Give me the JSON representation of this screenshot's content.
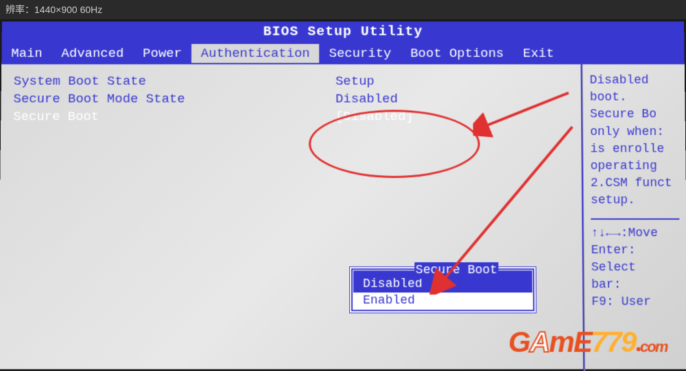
{
  "monitor": {
    "resolution_label": "辨率：1440×900 60Hz"
  },
  "bios": {
    "title": "BIOS Setup Utility",
    "menu": {
      "items": [
        {
          "label": "Main"
        },
        {
          "label": "Advanced"
        },
        {
          "label": "Power"
        },
        {
          "label": "Authentication"
        },
        {
          "label": "Security"
        },
        {
          "label": "Boot Options"
        },
        {
          "label": "Exit"
        }
      ],
      "active_index": 3
    },
    "settings": [
      {
        "label": "System Boot State",
        "value": "Setup",
        "selected": false
      },
      {
        "label": "Secure Boot Mode State",
        "value": "Disabled",
        "selected": false
      },
      {
        "label": "Secure Boot",
        "value": "[Disabled]",
        "selected": true
      }
    ],
    "popup": {
      "title": "Secure Boot",
      "options": [
        {
          "label": "Disabled",
          "selected": false
        },
        {
          "label": "Enabled",
          "selected": true
        }
      ]
    },
    "help": {
      "lines": [
        "Disabled",
        "boot.",
        "Secure Bo",
        "only when:",
        "is enrolle",
        "operating",
        "2.CSM funct",
        "setup."
      ],
      "nav": [
        "↑↓←→:Move",
        "Enter: Select",
        "bar:",
        "F9: User"
      ]
    }
  },
  "watermark": {
    "text": "GAME779.com"
  }
}
